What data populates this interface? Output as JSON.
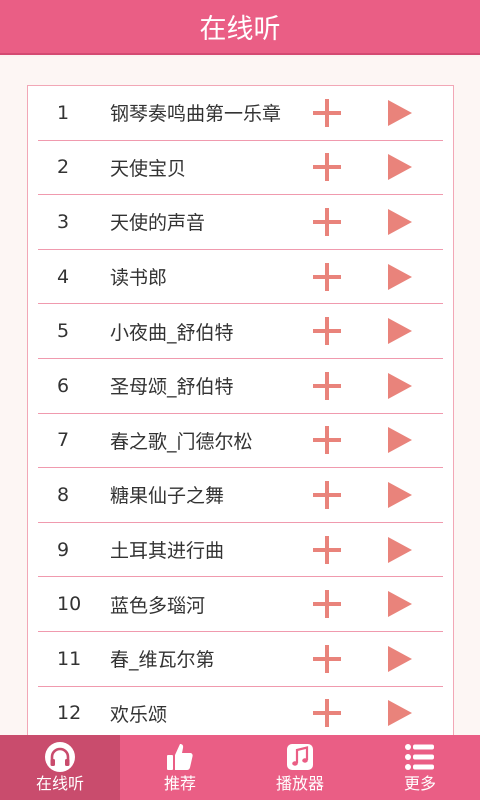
{
  "header": {
    "title": "在线听"
  },
  "songs": [
    {
      "num": "1",
      "title": "钢琴奏鸣曲第一乐章"
    },
    {
      "num": "2",
      "title": "天使宝贝"
    },
    {
      "num": "3",
      "title": "天使的声音"
    },
    {
      "num": "4",
      "title": "读书郎"
    },
    {
      "num": "5",
      "title": "小夜曲_舒伯特"
    },
    {
      "num": "6",
      "title": "圣母颂_舒伯特"
    },
    {
      "num": "7",
      "title": "春之歌_门德尔松"
    },
    {
      "num": "8",
      "title": "糖果仙子之舞"
    },
    {
      "num": "9",
      "title": "土耳其进行曲"
    },
    {
      "num": "10",
      "title": "蓝色多瑙河"
    },
    {
      "num": "11",
      "title": "春_维瓦尔第"
    },
    {
      "num": "12",
      "title": "欢乐颂"
    }
  ],
  "row_icons": {
    "add": "plus-icon",
    "play": "play-triangle-icon"
  },
  "tabs": [
    {
      "label": "在线听",
      "icon": "headphones-icon",
      "active": true
    },
    {
      "label": "推荐",
      "icon": "thumbs-up-icon",
      "active": false
    },
    {
      "label": "播放器",
      "icon": "music-note-icon",
      "active": false
    },
    {
      "label": "更多",
      "icon": "list-menu-icon",
      "active": false
    }
  ],
  "colors": {
    "accent": "#ea5e85",
    "accent_dark": "#c94c6d",
    "icon_color": "#e9837b",
    "divider": "#f09aae"
  }
}
